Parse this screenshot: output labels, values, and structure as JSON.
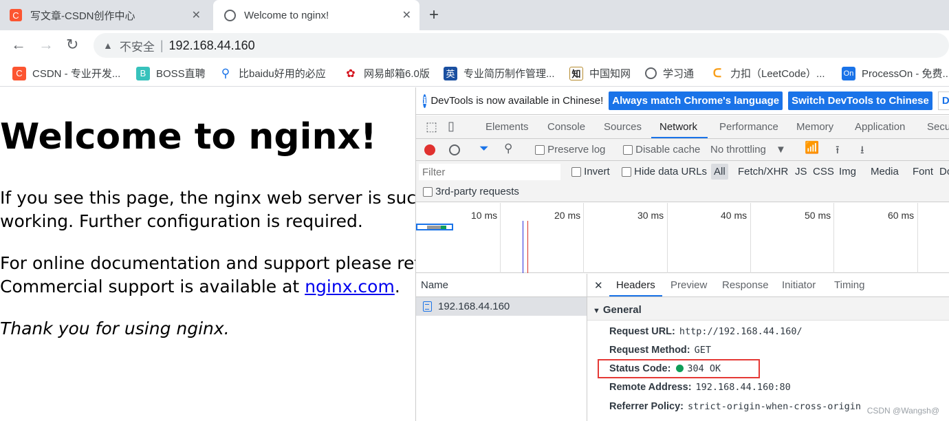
{
  "browser": {
    "tabs": [
      {
        "title": "写文章-CSDN创作中心",
        "favicon": "csdn-c",
        "color": "#fc5531"
      },
      {
        "title": "Welcome to nginx!",
        "favicon": "globe-icon"
      }
    ],
    "address": {
      "security": "不安全",
      "url": "192.168.44.160"
    },
    "bookmarks": [
      {
        "label": "CSDN - 专业开发...",
        "icon": "C",
        "color": "#fc5531"
      },
      {
        "label": "BOSS直聘",
        "icon": "B",
        "color": "#37c2bc"
      },
      {
        "label": "比baidu好用的必应",
        "icon": "search",
        "color": "#1a73e8"
      },
      {
        "label": "网易邮箱6.0版",
        "icon": "netease",
        "color": "#d4101b"
      },
      {
        "label": "专业简历制作管理...",
        "icon": "英",
        "color": "#1a4fa0"
      },
      {
        "label": "中国知网",
        "icon": "知",
        "color": "#222222"
      },
      {
        "label": "学习通",
        "icon": "globe",
        "color": "#5f6368"
      },
      {
        "label": "力扣（LeetCode）...",
        "icon": "leetcode",
        "color": "#f89f1b"
      },
      {
        "label": "ProcessOn - 免费...",
        "icon": "On",
        "color": "#1a73e8"
      }
    ]
  },
  "page": {
    "heading": "Welcome to nginx!",
    "para1_line1": "If you see this page, the nginx web server is successfully installed and",
    "para1_line2": "working. Further configuration is required.",
    "para2_line1": "For online documentation and support please refer to nginx.org.",
    "para2_line2_prefix": "Commercial support is available at ",
    "para2_link": "nginx.com",
    "para2_suffix": ".",
    "thanks": "Thank you for using nginx."
  },
  "devtools": {
    "info": {
      "message": "DevTools is now available in Chinese!",
      "btn_match": "Always match Chrome's language",
      "btn_switch": "Switch DevTools to Chinese",
      "btn_dont": "Don't"
    },
    "tabs": [
      "Elements",
      "Console",
      "Sources",
      "Network",
      "Performance",
      "Memory",
      "Application",
      "Secu"
    ],
    "active_tab": "Network",
    "network_toolbar": {
      "preserve_log": "Preserve log",
      "disable_cache": "Disable cache",
      "throttling": "No throttling"
    },
    "filter_bar": {
      "placeholder": "Filter",
      "invert": "Invert",
      "hide_data_urls": "Hide data URLs",
      "types": [
        "All",
        "Fetch/XHR",
        "JS",
        "CSS",
        "Img",
        "Media",
        "Font",
        "Doc"
      ],
      "third_party": "3rd-party requests"
    },
    "timeline_ticks": [
      "10 ms",
      "20 ms",
      "30 ms",
      "40 ms",
      "50 ms",
      "60 ms"
    ],
    "name_header": "Name",
    "requests": [
      "192.168.44.160"
    ],
    "detail_tabs": [
      "Headers",
      "Preview",
      "Response",
      "Initiator",
      "Timing"
    ],
    "general": {
      "title": "General",
      "request_url_label": "Request URL:",
      "request_url": "http://192.168.44.160/",
      "method_label": "Request Method:",
      "method": "GET",
      "status_label": "Status Code:",
      "status": "304 OK",
      "remote_label": "Remote Address:",
      "remote": "192.168.44.160:80",
      "referrer_label": "Referrer Policy:",
      "referrer": "strict-origin-when-cross-origin"
    }
  },
  "watermark": "CSDN @Wangsh@"
}
